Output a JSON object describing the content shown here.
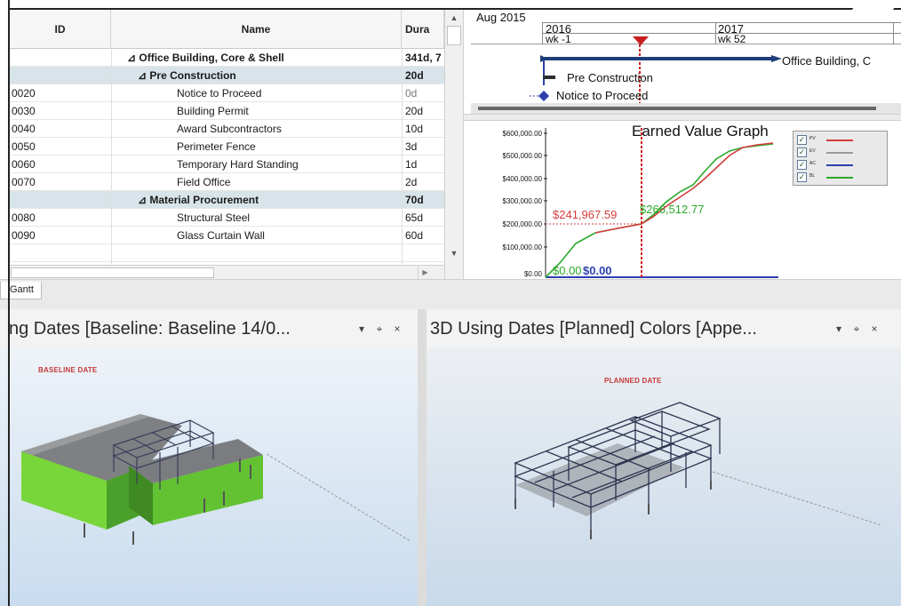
{
  "grid": {
    "columns": {
      "id": "ID",
      "name": "Name",
      "duration": "Dura"
    },
    "rows": [
      {
        "id": "",
        "name": "⊿ Office Building, Core & Shell",
        "duration": "341d, 7",
        "kind": "summary-top"
      },
      {
        "id": "",
        "name": "⊿ Pre Construction",
        "duration": "20d",
        "kind": "summary"
      },
      {
        "id": "0020",
        "name": "Notice to Proceed",
        "duration": "0d",
        "kind": "task"
      },
      {
        "id": "0030",
        "name": "Building Permit",
        "duration": "20d",
        "kind": "task"
      },
      {
        "id": "0040",
        "name": "Award Subcontractors",
        "duration": "10d",
        "kind": "task"
      },
      {
        "id": "0050",
        "name": "Perimeter Fence",
        "duration": "3d",
        "kind": "task"
      },
      {
        "id": "0060",
        "name": "Temporary Hard Standing",
        "duration": "1d",
        "kind": "task"
      },
      {
        "id": "0070",
        "name": "Field Office",
        "duration": "2d",
        "kind": "task"
      },
      {
        "id": "",
        "name": "⊿ Material Procurement",
        "duration": "70d",
        "kind": "summary"
      },
      {
        "id": "0080",
        "name": "Structural Steel",
        "duration": "65d",
        "kind": "task"
      },
      {
        "id": "0090",
        "name": "Glass Curtain Wall",
        "duration": "60d",
        "kind": "task"
      }
    ]
  },
  "gantt": {
    "top_label": "Aug 2015",
    "years": [
      "2016",
      "2017"
    ],
    "weeks": [
      "wk -1",
      "wk 52"
    ],
    "bars": {
      "project": "Office Building, C",
      "pre_construction": "Pre Construction",
      "notice": "Notice to Proceed"
    }
  },
  "ev_graph": {
    "title": "Earned Value Graph",
    "y_ticks": [
      "$600,000.00",
      "$500,000.00",
      "$400,000.00",
      "$300,000.00",
      "$200,000.00",
      "$100,000.00",
      "$0.00"
    ],
    "annotations": {
      "value_a": "$241,967.59",
      "value_b": "$266,512.77",
      "zero_a": "$0.00",
      "zero_b": "$0.00"
    },
    "legend": [
      {
        "label": "PV",
        "color": "#d23b3b"
      },
      {
        "label": "EV",
        "color": "#9a9a9a"
      },
      {
        "label": "AC",
        "color": "#2b3fae"
      },
      {
        "label": "BL",
        "color": "#2aa82a"
      }
    ]
  },
  "tabs": {
    "gantt": "Gantt"
  },
  "panels": {
    "left": {
      "title": "ng Dates [Baseline: Baseline 14/0...",
      "viewport_label": "BASELINE DATE"
    },
    "right": {
      "title": "3D Using Dates [Planned] Colors [Appe...",
      "viewport_label": "PLANNED DATE"
    },
    "controls": {
      "dropdown": "▾",
      "pin": "⌖",
      "close": "×"
    }
  }
}
